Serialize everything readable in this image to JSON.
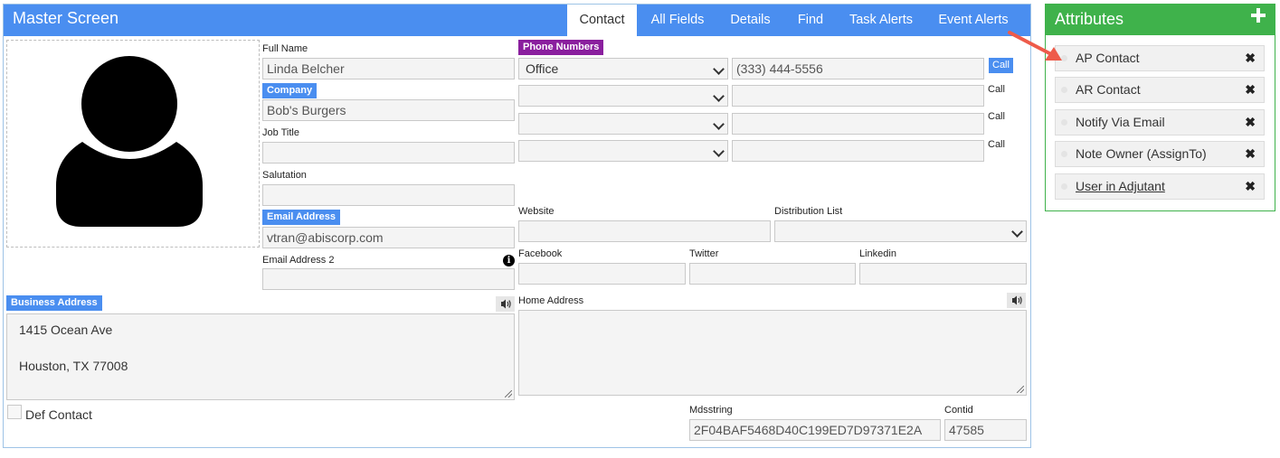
{
  "header": {
    "title": "Master Screen",
    "tabs": [
      "Contact",
      "All Fields",
      "Details",
      "Find",
      "Task Alerts",
      "Event Alerts"
    ]
  },
  "form": {
    "full_name_label": "Full Name",
    "full_name": "Linda Belcher",
    "company_label": "Company",
    "company": "Bob's Burgers",
    "job_title_label": "Job Title",
    "job_title": "",
    "salutation_label": "Salutation",
    "salutation": "",
    "email_label": "Email Address",
    "email": "vtran@abiscorp.com",
    "email2_label": "Email Address 2",
    "email2": "",
    "phone_label": "Phone Numbers",
    "phones": [
      {
        "type": "Office",
        "number": "(333) 444-5556",
        "call": "Call"
      },
      {
        "type": "",
        "number": "",
        "call": "Call"
      },
      {
        "type": "",
        "number": "",
        "call": "Call"
      },
      {
        "type": "",
        "number": "",
        "call": "Call"
      }
    ],
    "website_label": "Website",
    "website": "",
    "distribution_label": "Distribution List",
    "distribution": "",
    "facebook_label": "Facebook",
    "twitter_label": "Twitter",
    "linkedin_label": "Linkedin",
    "business_address_label": "Business Address",
    "business_address_line1": "1415 Ocean Ave",
    "business_address_line2": "Houston, TX 77008",
    "home_address_label": "Home Address",
    "home_address": "",
    "def_contact_label": "Def Contact",
    "mdsstring_label": "Mdsstring",
    "mdsstring": "2F04BAF5468D40C199ED7D97371E2A",
    "contid_label": "Contid",
    "contid": "47585"
  },
  "attributes": {
    "title": "Attributes",
    "items": [
      "AP Contact",
      "AR Contact",
      "Notify Via Email",
      "Note Owner (AssignTo)",
      "User in Adjutant"
    ]
  },
  "colors": {
    "header_blue": "#4a8ef0",
    "badge_purple": "#8a1f9e",
    "attr_green": "#3fb24b",
    "arrow_red": "#ee5b4a"
  }
}
